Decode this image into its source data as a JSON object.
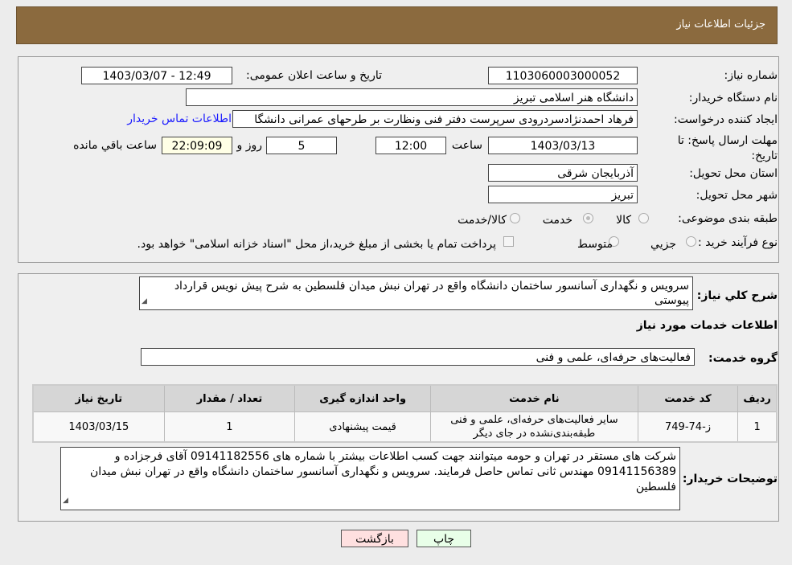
{
  "header": {
    "title": "جزئیات اطلاعات نیاز"
  },
  "form": {
    "need_number_label": "شماره نیاز:",
    "need_number": "1103060003000052",
    "announce_label": "تاریخ و ساعت اعلان عمومی:",
    "announce_value": "1403/03/07 - 12:49",
    "buyer_org_label": "نام دستگاه خریدار:",
    "buyer_org": "دانشگاه هنر اسلامی تبریز",
    "creator_label": "ایجاد کننده درخواست:",
    "creator": "فرهاد احمدنژادسردرودی سرپرست دفتر فنی ونظارت بر طرحهای عمرانی دانشگا",
    "contact_link": "اطلاعات تماس خریدار",
    "deadline_label": "مهلت ارسال پاسخ: تا تاریخ:",
    "deadline_date": "1403/03/13",
    "time_label": "ساعت",
    "deadline_time": "12:00",
    "days": "5",
    "days_label": "روز و",
    "remaining": "22:09:09",
    "remaining_label": "ساعت باقي مانده",
    "province_label": "استان محل تحویل:",
    "province": "آذربایجان شرقی",
    "city_label": "شهر محل تحویل:",
    "city": "تبریز",
    "category_label": "طبقه بندی موضوعی:",
    "category_options": [
      "کالا",
      "خدمت",
      "کالا/خدمت"
    ],
    "category_selected": "خدمت",
    "process_label": "نوع فرآیند خرید :",
    "process_options": [
      "جزیي",
      "متوسط"
    ],
    "process_note": "پرداخت تمام یا بخشی از مبلغ خرید،از محل \"اسناد خزانه اسلامی\" خواهد بود."
  },
  "details": {
    "summary_label": "شرح كلي نياز:",
    "summary": "سرویس و نگهداری آسانسور ساختمان دانشگاه واقع در تهران نبش میدان فلسطین به شرح پیش نویس قرارداد پیوستی",
    "services_heading": "اطلاعات خدمات مورد نیاز",
    "group_label": "گروه خدمت:",
    "group": "فعالیت‌های حرفه‌ای، علمی و فنی",
    "table": {
      "headers": [
        "ردیف",
        "کد خدمت",
        "نام خدمت",
        "واحد اندازه گیری",
        "تعداد / مقدار",
        "تاریخ نیاز"
      ],
      "rows": [
        [
          "1",
          "ز-74-749",
          "سایر فعالیت‌های حرفه‌ای، علمی و فنی طبقه‌بندی‌نشده در جای دیگر",
          "قیمت پیشنهادی",
          "1",
          "1403/03/15"
        ]
      ]
    },
    "buyer_notes_label": "توضیحات خریدار:",
    "buyer_notes": "شرکت های مستقر در تهران و حومه میتوانند جهت کسب اطلاعات بیشتر با شماره های 09141182556 آقای فرجزاده و 09141156389 مهندس ثانی تماس حاصل فرمایند. سرویس و نگهداری آسانسور ساختمان دانشگاه واقع در تهران نبش میدان فلسطین"
  },
  "buttons": {
    "print": "چاپ",
    "back": "بازگشت"
  },
  "colors": {
    "header": "#8b6a3e",
    "link": "#1a1aff",
    "back_button": "#ffe0e0",
    "print_button": "#e8ffe8"
  }
}
